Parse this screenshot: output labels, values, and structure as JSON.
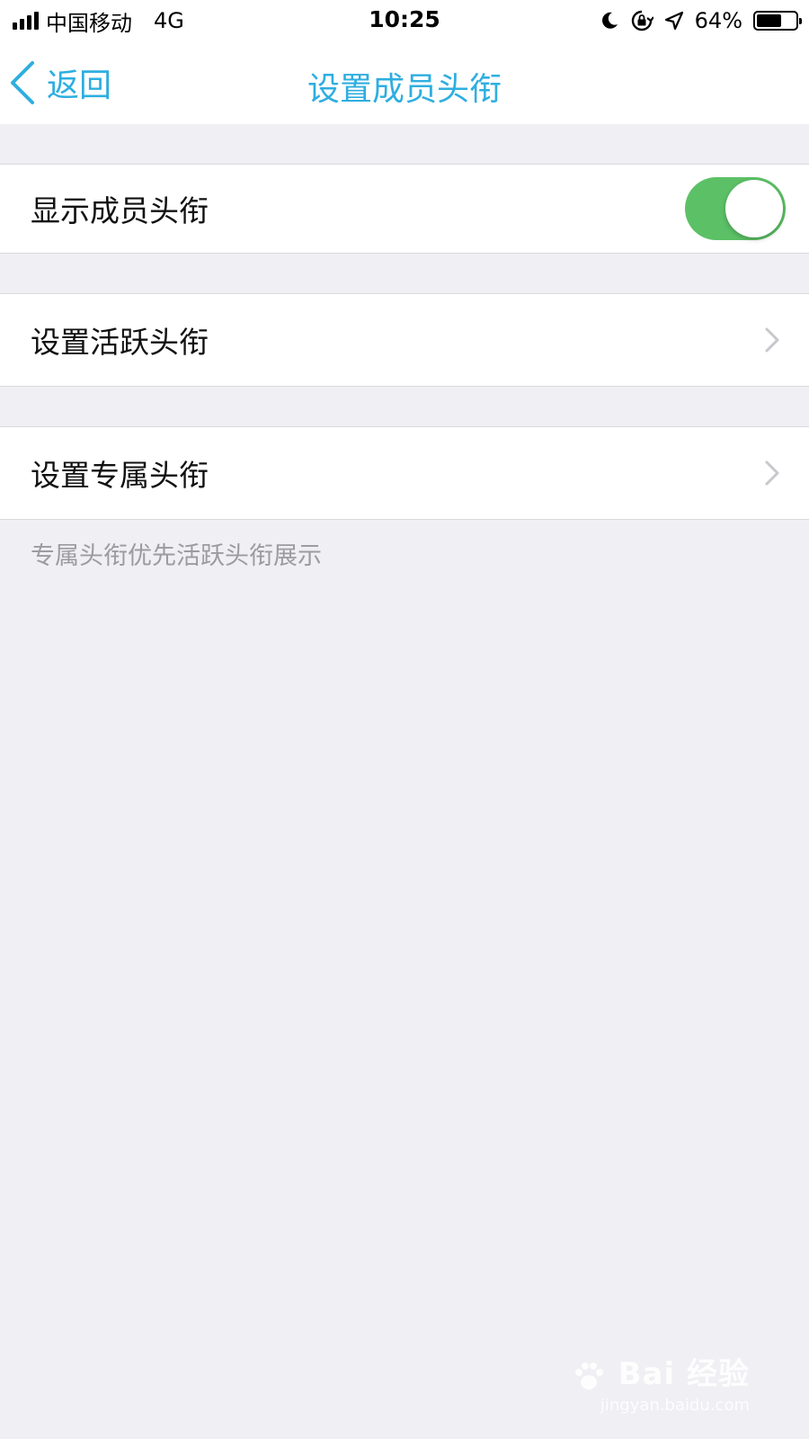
{
  "status_bar": {
    "carrier": "中国移动",
    "network": "4G",
    "time": "10:25",
    "battery_percent": "64%",
    "battery_level": 0.64,
    "icons": [
      "signal-icon",
      "moon-icon",
      "orientation-lock-icon",
      "location-icon",
      "battery-icon"
    ]
  },
  "nav": {
    "back_label": "返回",
    "title": "设置成员头衔"
  },
  "settings": {
    "show_title": {
      "label": "显示成员头衔",
      "toggle_on": true
    },
    "active_title": {
      "label": "设置活跃头衔"
    },
    "exclusive_title": {
      "label": "设置专属头衔"
    },
    "note": "专属头衔优先活跃头衔展示"
  },
  "watermark": {
    "brand": "Bai  经验",
    "url": "jingyan.baidu.com"
  },
  "colors": {
    "accent": "#2eaee0",
    "toggle_on": "#5cc166",
    "background": "#efeff4",
    "note_text": "#9b9ba0"
  }
}
